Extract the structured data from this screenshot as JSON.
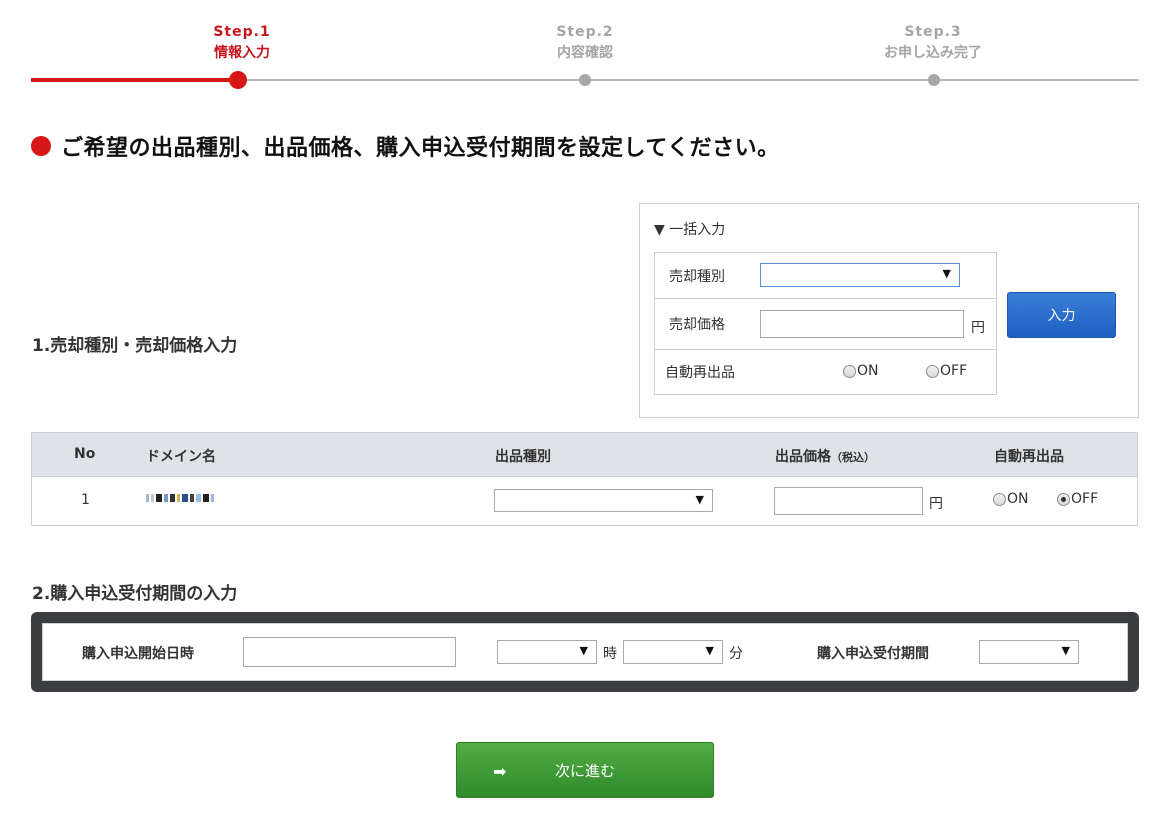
{
  "stepper": {
    "steps": [
      {
        "num": "Step.1",
        "name": "情報入力",
        "state": "active"
      },
      {
        "num": "Step.2",
        "name": "内容確認",
        "state": "inactive"
      },
      {
        "num": "Step.3",
        "name": "お申し込み完了",
        "state": "inactive"
      }
    ]
  },
  "heading": "ご希望の出品種別、出品価格、購入申込受付期間を設定してください。",
  "batch": {
    "title": "▼ 一括入力",
    "sale_type_label": "売却種別",
    "sale_type_value": "",
    "sale_price_label": "売却価格",
    "sale_price_value": "",
    "yen": "円",
    "relist_label": "自動再出品",
    "on": "ON",
    "off": "OFF",
    "input_button": "入力"
  },
  "section1_title": "1.売却種別・売却価格入力",
  "table": {
    "headers": {
      "no": "No",
      "domain": "ドメイン名",
      "type": "出品種別",
      "price": "出品価格",
      "price_note": "（税込）",
      "relist": "自動再出品"
    },
    "rows": [
      {
        "no": "1",
        "type_value": "",
        "price_value": "",
        "yen": "円",
        "on": "ON",
        "off": "OFF",
        "relist": "OFF"
      }
    ]
  },
  "section2_title": "2.購入申込受付期間の入力",
  "period": {
    "start_label": "購入申込開始日時",
    "date_value": "",
    "hour_value": "",
    "hour_unit": "時",
    "minute_value": "",
    "minute_unit": "分",
    "period_label": "購入申込受付期間",
    "period_value": ""
  },
  "next_button": "次に進む",
  "colors": {
    "accent_red": "#d71618",
    "button_blue": "#2a6fcc",
    "button_green": "#3f9c38"
  }
}
